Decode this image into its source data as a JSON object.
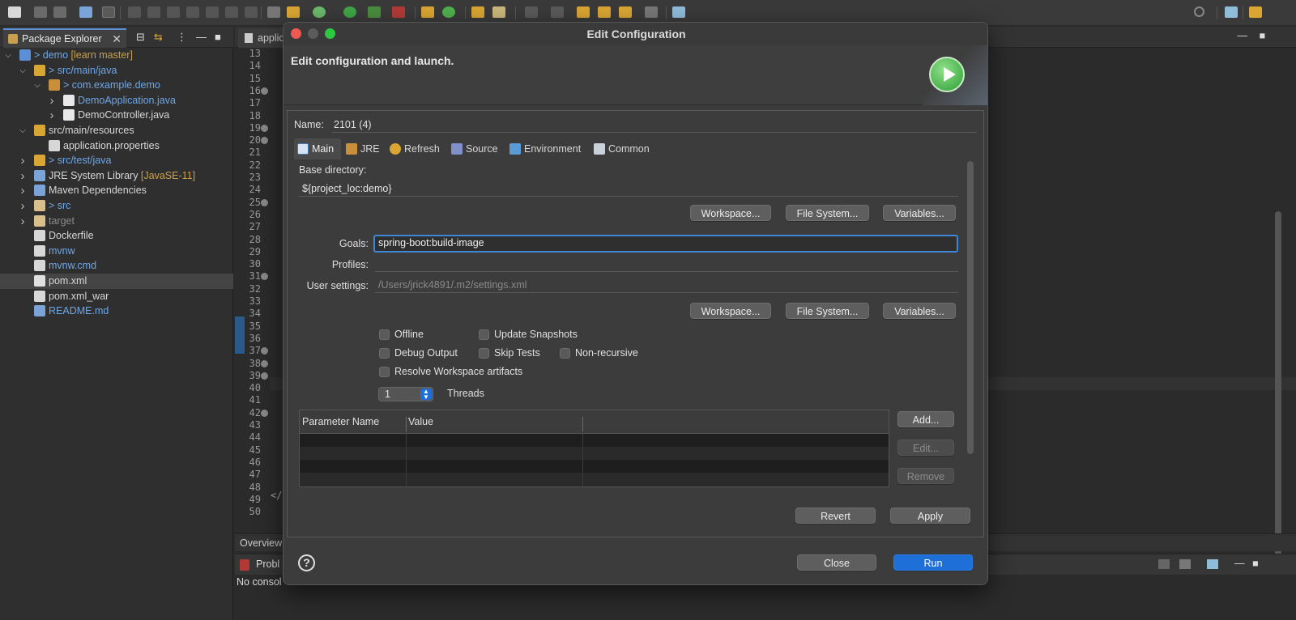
{
  "explorer": {
    "tab_label": "Package Explorer",
    "tree": [
      {
        "label": "> demo",
        "suffix": " [learn master]",
        "color": "blue",
        "depth": 0,
        "chevron": "open",
        "icon": "project-icon"
      },
      {
        "label": "> src/main/java",
        "color": "blue",
        "depth": 1,
        "chevron": "open",
        "icon": "source-folder-icon"
      },
      {
        "label": "> com.example.demo",
        "color": "blue",
        "depth": 2,
        "chevron": "open",
        "icon": "package-icon"
      },
      {
        "label": "DemoApplication.java",
        "color": "blue",
        "depth": 3,
        "chevron": "closed",
        "icon": "java-file-icon"
      },
      {
        "label": "DemoController.java",
        "color": "white",
        "depth": 3,
        "chevron": "closed",
        "icon": "java-file-icon"
      },
      {
        "label": "src/main/resources",
        "color": "white",
        "depth": 1,
        "chevron": "open",
        "icon": "source-folder-icon"
      },
      {
        "label": "application.properties",
        "color": "white",
        "depth": 2,
        "chevron": "none",
        "icon": "properties-file-icon"
      },
      {
        "label": "> src/test/java",
        "color": "blue",
        "depth": 1,
        "chevron": "closed",
        "icon": "source-folder-icon"
      },
      {
        "label": "JRE System Library",
        "suffix": " [JavaSE-11]",
        "color": "white",
        "depth": 1,
        "chevron": "closed",
        "icon": "library-icon"
      },
      {
        "label": "Maven Dependencies",
        "color": "white",
        "depth": 1,
        "chevron": "closed",
        "icon": "library-icon"
      },
      {
        "label": "> src",
        "color": "blue",
        "depth": 1,
        "chevron": "closed",
        "icon": "folder-icon"
      },
      {
        "label": "target",
        "color": "gray",
        "depth": 1,
        "chevron": "closed",
        "icon": "folder-icon"
      },
      {
        "label": "Dockerfile",
        "color": "white",
        "depth": 1,
        "chevron": "none",
        "icon": "file-icon"
      },
      {
        "label": "mvnw",
        "color": "blue",
        "depth": 1,
        "chevron": "none",
        "icon": "file-icon"
      },
      {
        "label": "mvnw.cmd",
        "color": "blue",
        "depth": 1,
        "chevron": "none",
        "icon": "file-icon"
      },
      {
        "label": "pom.xml",
        "color": "white",
        "depth": 1,
        "chevron": "none",
        "icon": "xml-file-icon",
        "selected": true
      },
      {
        "label": "pom.xml_war",
        "color": "white",
        "depth": 1,
        "chevron": "none",
        "icon": "file-icon"
      },
      {
        "label": "README.md",
        "color": "blue",
        "depth": 1,
        "chevron": "none",
        "icon": "markdown-file-icon"
      }
    ]
  },
  "editor": {
    "tab_label": "applic",
    "line_numbers": [
      "13",
      "14",
      "15",
      "16",
      "17",
      "18",
      "19",
      "20",
      "21",
      "22",
      "23",
      "24",
      "25",
      "26",
      "27",
      "28",
      "29",
      "30",
      "31",
      "32",
      "33",
      "34",
      "35",
      "36",
      "37",
      "38",
      "39",
      "40",
      "41",
      "42",
      "43",
      "44",
      "45",
      "46",
      "47",
      "48",
      "49",
      "50"
    ],
    "fold_lines": [
      "16",
      "19",
      "20",
      "25",
      "31",
      "37",
      "38",
      "39",
      "42"
    ],
    "code_fragment": "</",
    "overview_tab": "Overview",
    "problems_tab": "Probl",
    "console_text": "No consol"
  },
  "dialog": {
    "title": "Edit Configuration",
    "banner_text": "Edit configuration and launch.",
    "name_label": "Name:",
    "name_value": "2101 (4)",
    "tabs": [
      {
        "label": "Main",
        "icon": "main-tab-icon",
        "active": true
      },
      {
        "label": "JRE",
        "icon": "jre-tab-icon"
      },
      {
        "label": "Refresh",
        "icon": "refresh-tab-icon"
      },
      {
        "label": "Source",
        "icon": "source-tab-icon"
      },
      {
        "label": "Environment",
        "icon": "environment-tab-icon"
      },
      {
        "label": "Common",
        "icon": "common-tab-icon"
      }
    ],
    "base_dir_label": "Base directory:",
    "base_dir_value": "${project_loc:demo}",
    "workspace_btn": "Workspace...",
    "filesystem_btn": "File System...",
    "variables_btn": "Variables...",
    "goals_label": "Goals:",
    "goals_value": "spring-boot:build-image",
    "profiles_label": "Profiles:",
    "profiles_value": "",
    "user_settings_label": "User settings:",
    "user_settings_placeholder": "/Users/jrick4891/.m2/settings.xml",
    "checkboxes": {
      "offline": "Offline",
      "update_snapshots": "Update Snapshots",
      "debug_output": "Debug Output",
      "skip_tests": "Skip Tests",
      "non_recursive": "Non-recursive",
      "resolve_workspace": "Resolve Workspace artifacts"
    },
    "threads_value": "1",
    "threads_label": "Threads",
    "param_table": {
      "col_name": "Parameter Name",
      "col_value": "Value"
    },
    "add_btn": "Add...",
    "edit_btn": "Edit...",
    "remove_btn": "Remove",
    "revert_btn": "Revert",
    "apply_btn": "Apply",
    "close_btn": "Close",
    "run_btn": "Run",
    "help_glyph": "?"
  },
  "colors": {
    "accent_blue": "#1f6fd8",
    "focus_ring": "#3f86d6",
    "link_blue": "#6ea7e6",
    "decorator_orange": "#c9a04d",
    "traffic_red": "#ee5a52",
    "traffic_yellow": "#5b5b5b",
    "traffic_green": "#2bc840"
  }
}
